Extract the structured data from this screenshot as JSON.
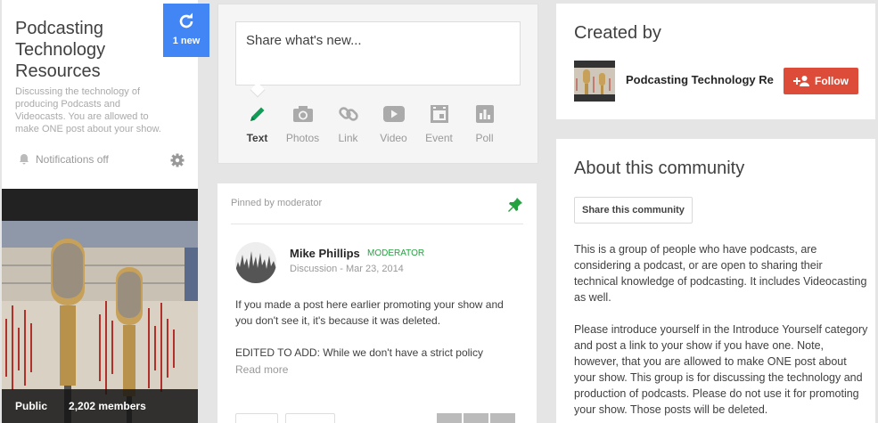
{
  "community": {
    "title": "Podcasting Technology Resources",
    "description": "Discussing the technology of producing Podcasts and Videocasts. You are allowed to make ONE post about your show.",
    "notifications": "Notifications off",
    "new_count": "1 new",
    "visibility": "Public",
    "members": "2,202 members"
  },
  "share": {
    "placeholder": "Share what's new...",
    "tools": [
      {
        "label": "Text",
        "icon": "pencil-icon"
      },
      {
        "label": "Photos",
        "icon": "camera-icon"
      },
      {
        "label": "Link",
        "icon": "link-icon"
      },
      {
        "label": "Video",
        "icon": "video-icon"
      },
      {
        "label": "Event",
        "icon": "event-icon"
      },
      {
        "label": "Poll",
        "icon": "poll-icon"
      }
    ]
  },
  "post": {
    "pinned_label": "Pinned by moderator",
    "author": "Mike Phillips",
    "badge": "MODERATOR",
    "category": "Discussion",
    "separator": "-",
    "date": "Mar 23, 2014",
    "body_1": "If you made a post here earlier promoting your show and you don't see it, it's because it was deleted.",
    "body_2": "EDITED TO ADD: While we don't have a strict policy",
    "read_more": "Read more"
  },
  "created_by": {
    "title": "Created by",
    "name": "Podcasting Technology Re",
    "follow": "Follow"
  },
  "about": {
    "title": "About this community",
    "share_button": "Share this community",
    "para_1": "This is a group of people who have podcasts, are considering a podcast, or are open to sharing their technical knowledge of podcasting. It includes Videocasting as well.",
    "para_2": "Please introduce yourself in the Introduce Yourself category and post a link to your show if you have one. Note, however, that you are allowed to make ONE post about your show. This group is for discussing the technology and production of podcasts. Please do not use it for promoting your show. Those posts will be deleted."
  },
  "colors": {
    "accent_blue": "#4285f4",
    "follow_red": "#dd4b39",
    "moderator_green": "#25a240"
  }
}
